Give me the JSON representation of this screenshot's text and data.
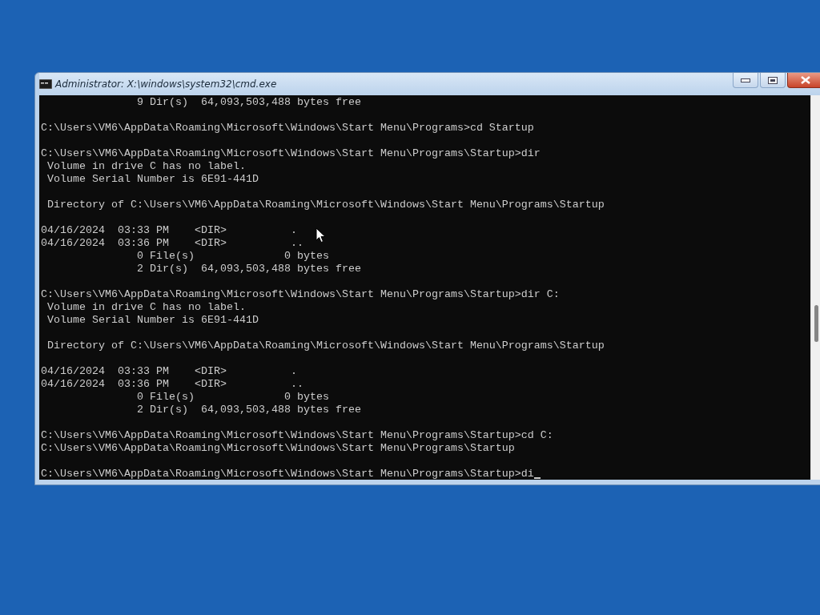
{
  "window": {
    "title": "Administrator: X:\\windows\\system32\\cmd.exe"
  },
  "console": {
    "lines": [
      {
        "kind": "text",
        "text": "               9 Dir(s)  64,093,503,488 bytes free"
      },
      {
        "kind": "blank"
      },
      {
        "kind": "text",
        "text": "C:\\Users\\VM6\\AppData\\Roaming\\Microsoft\\Windows\\Start Menu\\Programs>cd Startup"
      },
      {
        "kind": "blank"
      },
      {
        "kind": "text",
        "text": "C:\\Users\\VM6\\AppData\\Roaming\\Microsoft\\Windows\\Start Menu\\Programs\\Startup>dir"
      },
      {
        "kind": "text",
        "text": " Volume in drive C has no label."
      },
      {
        "kind": "text",
        "text": " Volume Serial Number is 6E91-441D"
      },
      {
        "kind": "blank"
      },
      {
        "kind": "text",
        "text": " Directory of C:\\Users\\VM6\\AppData\\Roaming\\Microsoft\\Windows\\Start Menu\\Programs\\Startup"
      },
      {
        "kind": "blank"
      },
      {
        "kind": "text",
        "text": "04/16/2024  03:33 PM    <DIR>          ."
      },
      {
        "kind": "text",
        "text": "04/16/2024  03:36 PM    <DIR>          .."
      },
      {
        "kind": "text",
        "text": "               0 File(s)              0 bytes"
      },
      {
        "kind": "text",
        "text": "               2 Dir(s)  64,093,503,488 bytes free"
      },
      {
        "kind": "blank"
      },
      {
        "kind": "text",
        "text": "C:\\Users\\VM6\\AppData\\Roaming\\Microsoft\\Windows\\Start Menu\\Programs\\Startup>dir C:"
      },
      {
        "kind": "text",
        "text": " Volume in drive C has no label."
      },
      {
        "kind": "text",
        "text": " Volume Serial Number is 6E91-441D"
      },
      {
        "kind": "blank"
      },
      {
        "kind": "text",
        "text": " Directory of C:\\Users\\VM6\\AppData\\Roaming\\Microsoft\\Windows\\Start Menu\\Programs\\Startup"
      },
      {
        "kind": "blank"
      },
      {
        "kind": "text",
        "text": "04/16/2024  03:33 PM    <DIR>          ."
      },
      {
        "kind": "text",
        "text": "04/16/2024  03:36 PM    <DIR>          .."
      },
      {
        "kind": "text",
        "text": "               0 File(s)              0 bytes"
      },
      {
        "kind": "text",
        "text": "               2 Dir(s)  64,093,503,488 bytes free"
      },
      {
        "kind": "blank"
      },
      {
        "kind": "text",
        "text": "C:\\Users\\VM6\\AppData\\Roaming\\Microsoft\\Windows\\Start Menu\\Programs\\Startup>cd C:"
      },
      {
        "kind": "text",
        "text": "C:\\Users\\VM6\\AppData\\Roaming\\Microsoft\\Windows\\Start Menu\\Programs\\Startup"
      },
      {
        "kind": "blank"
      },
      {
        "kind": "prompt",
        "text": "C:\\Users\\VM6\\AppData\\Roaming\\Microsoft\\Windows\\Start Menu\\Programs\\Startup>di"
      }
    ]
  }
}
